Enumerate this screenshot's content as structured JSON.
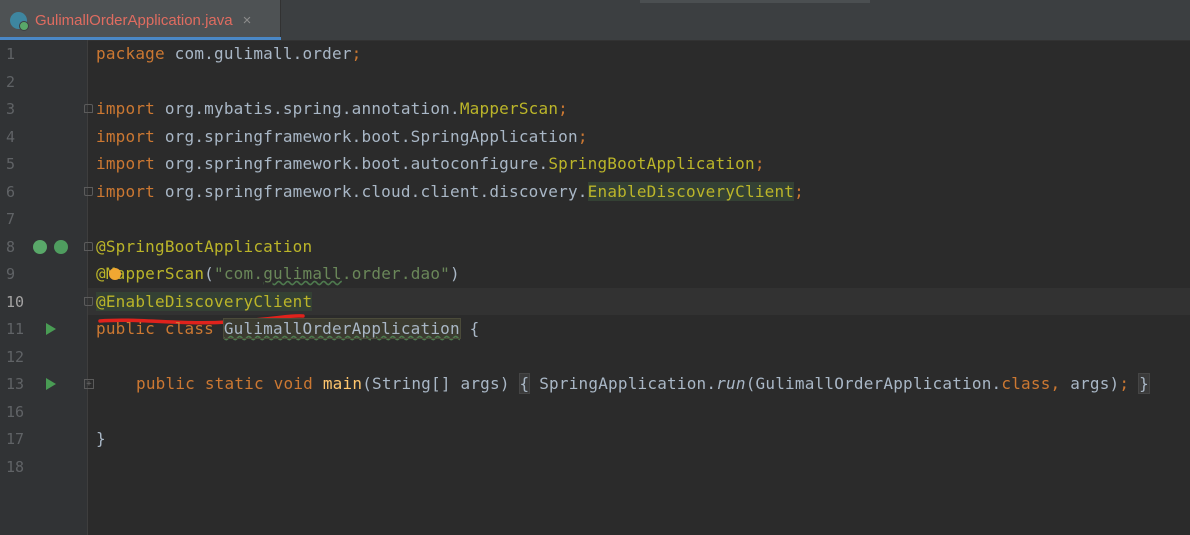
{
  "tab": {
    "title": "GulimallOrderApplication.java",
    "close": "×"
  },
  "gutter": {
    "line_numbers": [
      "1",
      "2",
      "3",
      "4",
      "5",
      "6",
      "7",
      "8",
      "9",
      "10",
      "11",
      "12",
      "13",
      "16",
      "17",
      "18"
    ],
    "current_line": "10"
  },
  "code": {
    "l1_kw": "package",
    "l1_rest": " com.gulimall.order",
    "semi": ";",
    "import_kw": "import",
    "l3_pkg": " org.mybatis.spring.annotation.",
    "l3_cls": "MapperScan",
    "l4_pkg": " org.springframework.boot.SpringApplication",
    "l5_pkg": " org.springframework.boot.autoconfigure.",
    "l5_cls": "SpringBootApplication",
    "l6_pkg": " org.springframework.cloud.client.discovery.",
    "l6_cls": "EnableDiscoveryClient",
    "l8_ann": "@SpringBootApplication",
    "l9_at": "@",
    "l9_ann": "MapperScan",
    "l9_open": "(",
    "l9_str_a": "\"com.",
    "l9_str_b": "gulimall",
    "l9_str_c": ".order.dao\"",
    "l9_close": ")",
    "l10_ann": "@EnableDiscoveryClient",
    "l11_kw": "public class",
    "l11_cls": "GulimallOrderApplication",
    "l11_brace": " {",
    "l13_kw": "public static void",
    "l13_fn": "main",
    "l13_params": "(String[] args)",
    "l13_open": "{",
    "l13_call_a": " SpringApplication.",
    "l13_run": "run",
    "l13_call_b": "(GulimallOrderApplication.",
    "l13_class_kw": "class",
    "l13_comma": ",",
    "l13_args": " args)",
    "l13_close": "}",
    "l17_brace": "}"
  },
  "colors": {
    "keyword": "#cc7832",
    "annotation": "#bbb529",
    "string": "#6a8759",
    "method": "#ffc66d",
    "text": "#a9b7c6",
    "tab_title": "#e06c60",
    "red_mark": "#e0221c"
  },
  "icons": [
    "java-class-icon",
    "bean-icon",
    "run-icon",
    "bulb-icon",
    "fold-icon"
  ]
}
